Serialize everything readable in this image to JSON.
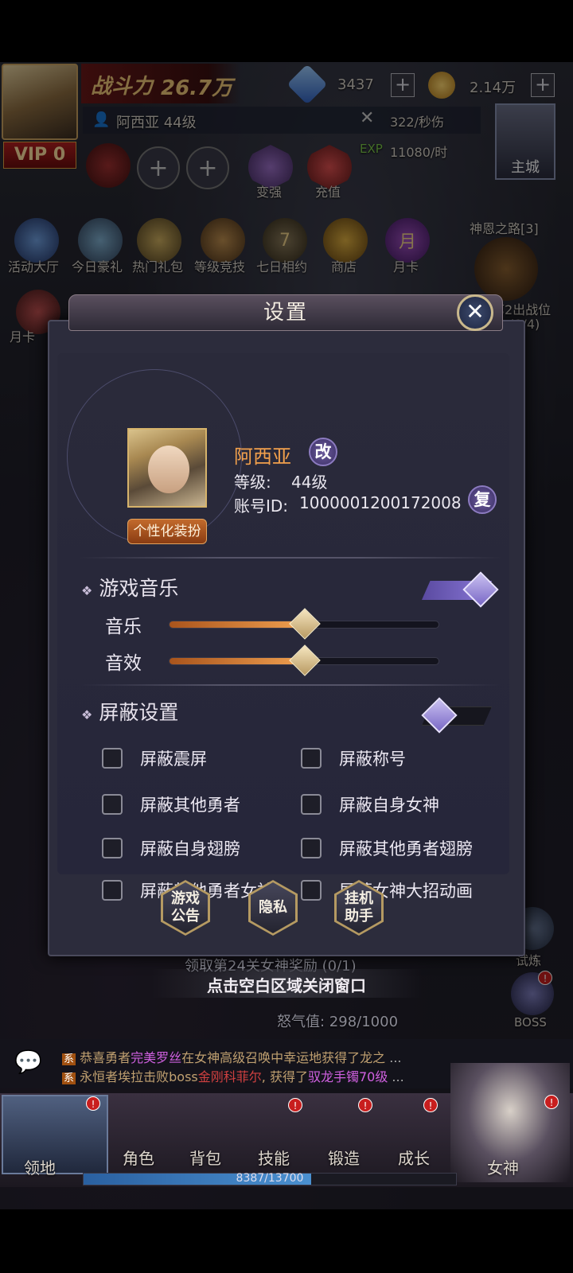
{
  "hud": {
    "power_label": "战斗力",
    "power_value": "26.7万",
    "diamonds": "3437",
    "gold": "2.14万",
    "player_line": "阿西亚 44级",
    "dps": "322/秒伤",
    "exp": "11080/时",
    "exp_label": "EXP",
    "vip": "VIP 0",
    "city": "主城",
    "plus": "+"
  },
  "top_icons": [
    "变强",
    "充值"
  ],
  "menu_icons": [
    "活动大厅",
    "今日豪礼",
    "热门礼包",
    "等级竞技",
    "七日相约",
    "商店",
    "月卡"
  ],
  "side_left": "月卡",
  "side_right": {
    "god_road": "神恩之路[3]",
    "battle": "第2出战位",
    "progress": "(1/4)",
    "trial": "试炼",
    "boss": "BOSS"
  },
  "dialog": {
    "title": "设置",
    "close": "✕",
    "name": "阿西亚",
    "rename": "改",
    "level_label": "等级:",
    "level_value": "44级",
    "account_label": "账号ID:",
    "account_value": "1000001200172008",
    "copy": "复",
    "customize": "个性化装扮",
    "music_section": "游戏音乐",
    "music_label": "音乐",
    "music_level": 0.5,
    "sfx_label": "音效",
    "sfx_level": 0.5,
    "music_toggle_on": true,
    "block_section": "屏蔽设置",
    "block_toggle_on": false,
    "checkboxes": [
      "屏蔽震屏",
      "屏蔽称号",
      "屏蔽其他勇者",
      "屏蔽自身女神",
      "屏蔽自身翅膀",
      "屏蔽其他勇者翅膀",
      "屏蔽其他勇者女神",
      "屏蔽女神大招动画"
    ],
    "btn_notice": "游戏\n公告",
    "btn_privacy": "隐私",
    "btn_auto": "挂机\n助手"
  },
  "hint": {
    "reward": "领取第24关女神奖励 (0/1)",
    "close_tip": "点击空白区域关闭窗口",
    "rage": "怒气值: 298/1000"
  },
  "chat": {
    "tag": "系",
    "line1_a": "恭喜勇者",
    "line1_b": "完美罗丝",
    "line1_c": "在女神高级召唤中幸运地获得了龙之",
    "line2_a": "永恒者埃拉",
    "line2_b": "击败boss",
    "line2_c": "金刚科菲尔",
    "line2_d": ", 获得了",
    "line2_e": "驭龙手镯70级",
    "ellipsis": "..."
  },
  "nav": {
    "territory": "领地",
    "role": "角色",
    "bag": "背包",
    "skill": "技能",
    "forge": "锻造",
    "growth": "成长",
    "goddess": "女神",
    "exp_bar": "8387/13700",
    "exp_fraction": 0.612
  },
  "colors": {
    "accent": "#f2a04c",
    "slider": "#f0a050",
    "toggle": "#7a68c6"
  }
}
